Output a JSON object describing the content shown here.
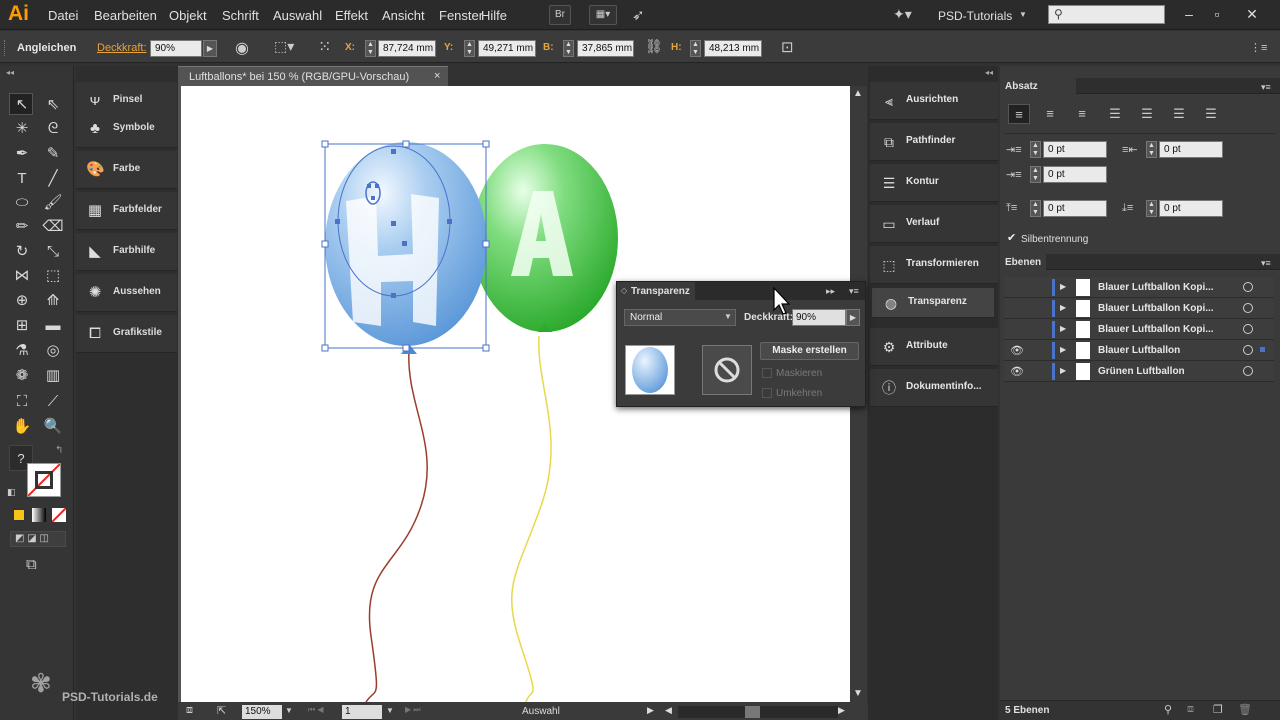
{
  "app": {
    "logo": "Ai",
    "workspace": "PSD-Tutorials",
    "bridge_label": "Br"
  },
  "menu": [
    "Datei",
    "Bearbeiten",
    "Objekt",
    "Schrift",
    "Auswahl",
    "Effekt",
    "Ansicht",
    "Fenster",
    "Hilfe"
  ],
  "control": {
    "align_label": "Angleichen",
    "opacity_label": "Deckkraft:",
    "opacity_value": "90%",
    "x_label": "X:",
    "x_value": "87,724 mm",
    "y_label": "Y:",
    "y_value": "49,271 mm",
    "w_label": "B:",
    "w_value": "37,865 mm",
    "h_label": "H:",
    "h_value": "48,213 mm"
  },
  "panels_left": [
    "Pinsel",
    "Symbole",
    "Farbe",
    "Farbfelder",
    "Farbhilfe",
    "Aussehen",
    "Grafikstile"
  ],
  "document": {
    "tab_title": "Luftballons* bei 150 % (RGB/GPU-Vorschau)",
    "close": "×"
  },
  "status": {
    "zoom": "150%",
    "page": "1",
    "tool": "Auswahl"
  },
  "panels_strip": [
    "Ausrichten",
    "Pathfinder",
    "Kontur",
    "Verlauf",
    "Transformieren",
    "Transparenz",
    "Attribute",
    "Dokumentinfo..."
  ],
  "paragraph": {
    "tab": "Absatz",
    "indent_left": "0 pt",
    "indent_right": "0 pt",
    "first_line": "0 pt",
    "space_before": "0 pt",
    "space_after": "0 pt",
    "hyphenation": "Silbentrennung"
  },
  "layers": {
    "tab": "Ebenen",
    "items": [
      "Blauer Luftballon Kopi...",
      "Blauer Luftballon Kopi...",
      "Blauer Luftballon Kopi...",
      "Blauer Luftballon",
      "Grünen Luftballon"
    ],
    "count": "5 Ebenen"
  },
  "transparency": {
    "title": "Transparenz",
    "mode": "Normal",
    "opacity_label": "Deckkraft:",
    "opacity_value": "90%",
    "make_mask": "Maske erstellen",
    "clip": "Maskieren",
    "invert": "Umkehren"
  },
  "watermark": "PSD-Tutorials.de",
  "colors": {
    "accent": "#ff9a00",
    "balloon_blue": "#6fa8e0",
    "balloon_green": "#3fbf3f",
    "selection": "#4a72c9"
  }
}
